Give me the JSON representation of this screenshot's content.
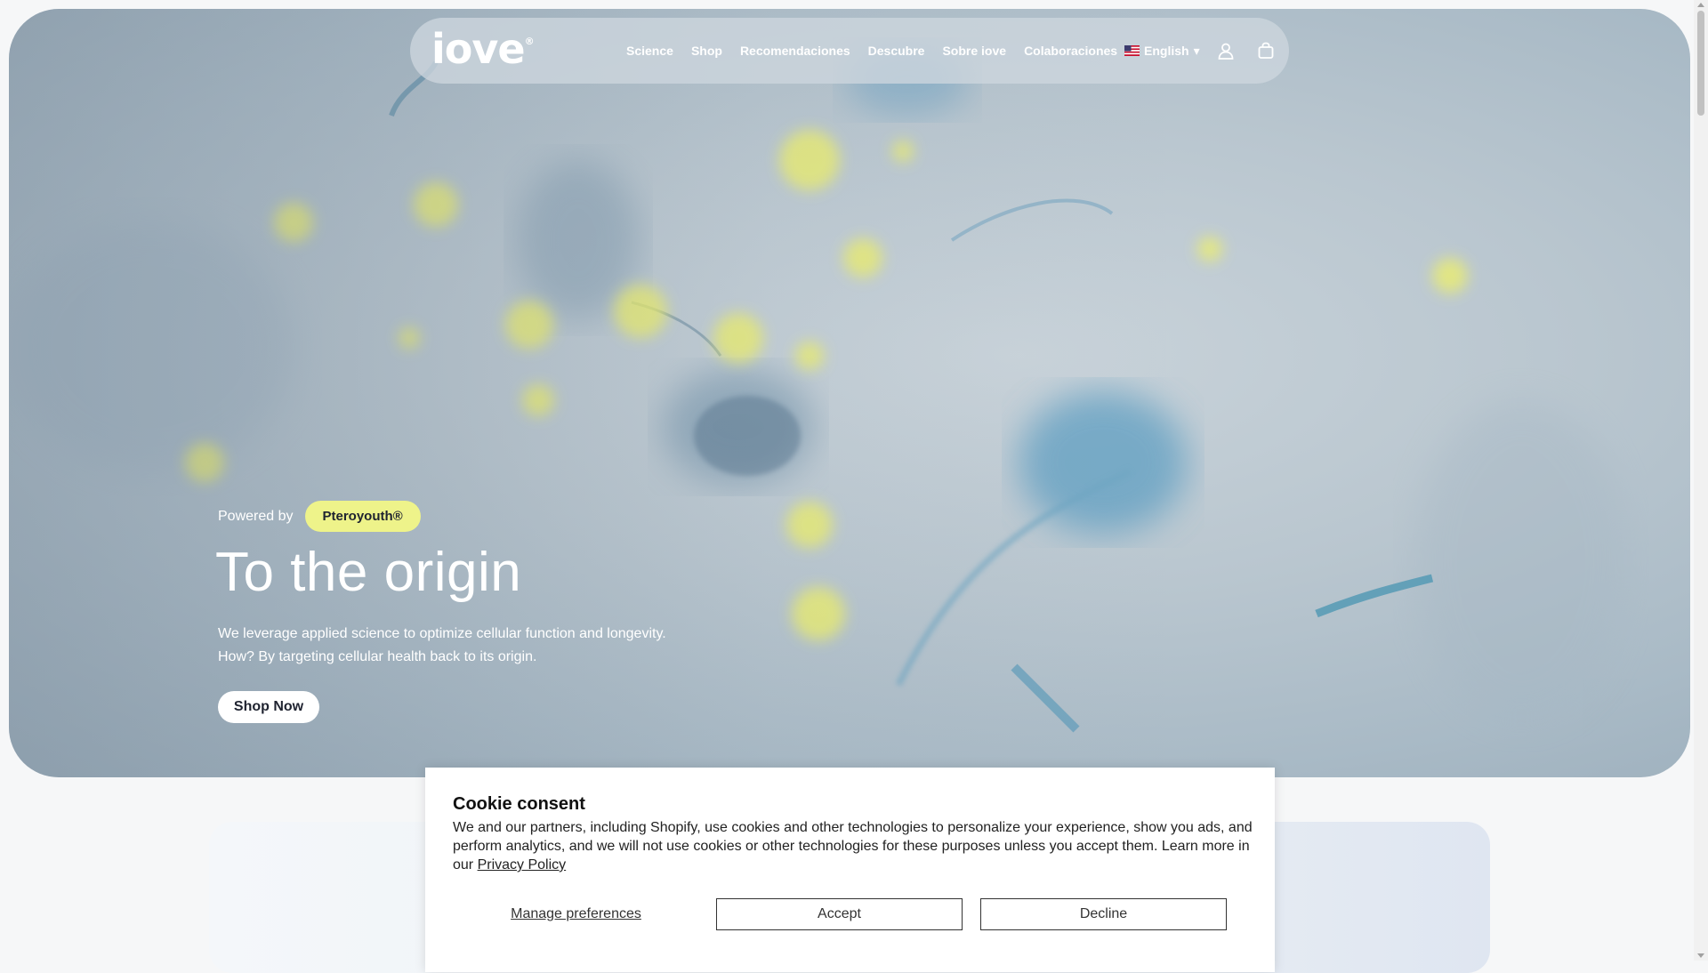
{
  "brand": {
    "logo_text": "iove",
    "logo_mark": "®"
  },
  "nav": {
    "links": [
      "Science",
      "Shop",
      "Recomendaciones",
      "Descubre",
      "Sobre iove",
      "Colaboraciones"
    ],
    "language": "English",
    "language_caret": "▾",
    "icons": [
      "user-icon",
      "shopping-bag-icon"
    ]
  },
  "hero": {
    "powered_label": "Powered by",
    "badge": "Pteroyouth®",
    "title": "To the origin",
    "desc_line1": "We leverage applied science to optimize cellular function and longevity.",
    "desc_line2": "How? By targeting cellular health back to its origin.",
    "cta": "Shop Now"
  },
  "cookie": {
    "title": "Cookie consent",
    "text": "We and our partners, including Shopify, use cookies and other technologies to personalize your experience, show you ads, and perform analytics, and we will not use cookies or other technologies for these purposes unless you accept them. Learn more in our ",
    "link": "Privacy Policy",
    "manage": "Manage preferences",
    "accept": "Accept",
    "decline": "Decline"
  },
  "colors": {
    "badge_bg": "#eef38a",
    "hero_bg": "#b9c6cf",
    "nav_bg": "#cdd6de",
    "text_dark": "#1f2330"
  }
}
